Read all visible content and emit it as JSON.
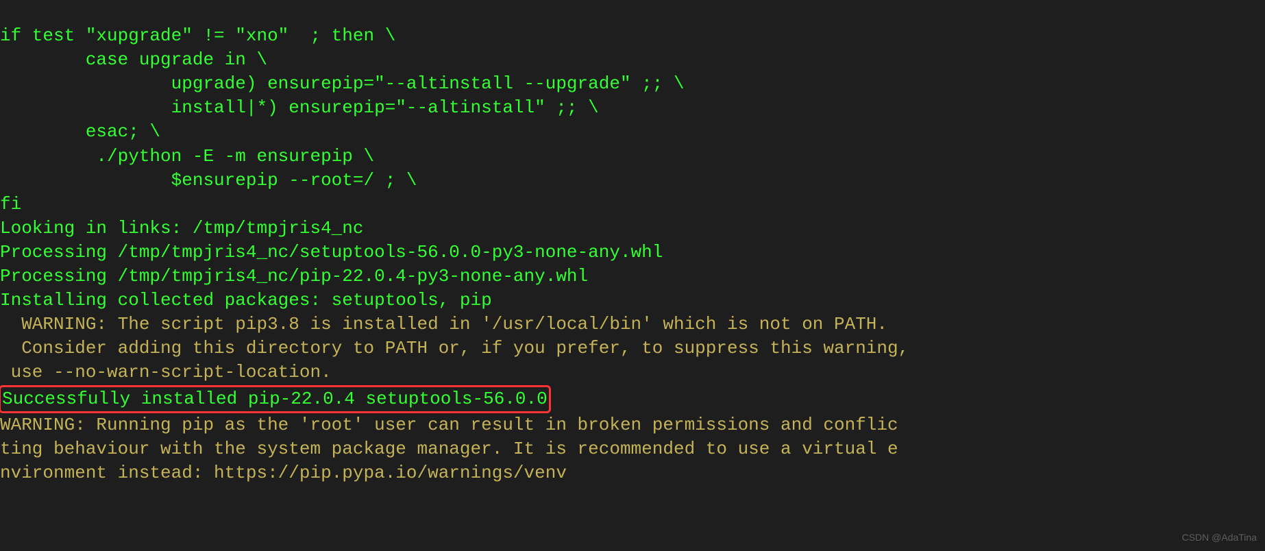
{
  "lines": {
    "l1": "if test \"xupgrade\" != \"xno\"  ; then \\",
    "l2": "        case upgrade in \\",
    "l3": "                upgrade) ensurepip=\"--altinstall --upgrade\" ;; \\",
    "l4": "                install|*) ensurepip=\"--altinstall\" ;; \\",
    "l5": "        esac; \\",
    "l6": "         ./python -E -m ensurepip \\",
    "l7": "                $ensurepip --root=/ ; \\",
    "l8": "fi",
    "l9": "Looking in links: /tmp/tmpjris4_nc",
    "l10": "Processing /tmp/tmpjris4_nc/setuptools-56.0.0-py3-none-any.whl",
    "l11": "Processing /tmp/tmpjris4_nc/pip-22.0.4-py3-none-any.whl",
    "l12": "Installing collected packages: setuptools, pip",
    "l13": "  WARNING: The script pip3.8 is installed in '/usr/local/bin' which is not on PATH.",
    "l14": "  Consider adding this directory to PATH or, if you prefer, to suppress this warning,",
    "l15": " use --no-warn-script-location.",
    "l16": "Successfully installed pip-22.0.4 setuptools-56.0.0",
    "l17": "WARNING: Running pip as the 'root' user can result in broken permissions and conflic",
    "l18": "ting behaviour with the system package manager. It is recommended to use a virtual e",
    "l19": "nvironment instead: https://pip.pypa.io/warnings/venv"
  },
  "watermark": "CSDN @AdaTina"
}
